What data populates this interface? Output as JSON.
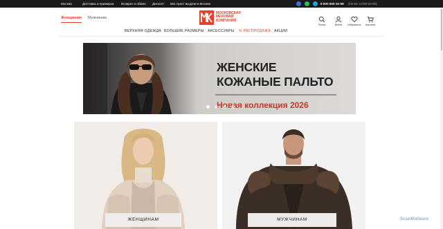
{
  "topbar": {
    "city": "Москва",
    "links": [
      "Доставка и примерка",
      "Возврат и обмен",
      "Дисконт",
      "561 пункт выдачи в Москве"
    ],
    "phone": "8 800 600-32-68",
    "hours": "(Пн-Вс 10:00-20:00)"
  },
  "gender_tabs": {
    "women": "Женщинам",
    "men": "Мужчинам"
  },
  "logo": {
    "mark": "МК",
    "line1": "МОСКОВСКАЯ",
    "line2": "МЕХОВАЯ",
    "line3": "КОМПАНИЯ"
  },
  "header_icons": {
    "search": "Поиск",
    "login": "Войти",
    "favorites": "Избранное",
    "cart": "Корзина"
  },
  "nav": [
    "ВЕРХНЯЯ ОДЕЖДА",
    "БОЛЬШИЕ РАЗМЕРЫ",
    "АКСЕССУАРЫ",
    "% РАСПРОДАЖА",
    "АКЦИИ"
  ],
  "banner": {
    "title_line1": "ЖЕНСКИЕ",
    "title_line2": "КОЖАНЫЕ ПАЛЬТО",
    "subtitle": "Новая коллекция 2026",
    "slide_count": 4,
    "active_slide": 1
  },
  "categories": {
    "women": "ЖЕНЩИНАМ",
    "men": "МУЖЧИНАМ"
  },
  "watermark": "ScanMalware",
  "colors": {
    "accent": "#e4412b",
    "topbar": "#1a1a1a",
    "sale": "#e4412b",
    "subtitle": "#c0392b"
  }
}
